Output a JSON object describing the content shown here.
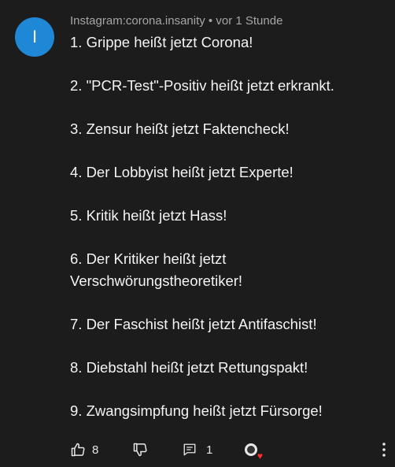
{
  "comment": {
    "avatar_letter": "I",
    "author": "Instagram:corona.insanity",
    "separator": " • ",
    "time": "vor 1 Stunde",
    "lines": [
      "1. Grippe heißt jetzt Corona!",
      "2. \"PCR-Test\"-Positiv heißt jetzt erkrankt.",
      "3. Zensur heißt jetzt Faktencheck!",
      "4. Der Lobbyist heißt jetzt Experte!",
      "5. Kritik heißt jetzt Hass!",
      "6. Der Kritiker heißt jetzt",
      "Verschwörungstheoretiker!",
      "7. Der Faschist heißt jetzt Antifaschist!",
      "8. Diebstahl heißt jetzt Rettungspakt!",
      "9. Zwangsimpfung heißt jetzt Fürsorge!"
    ]
  },
  "actions": {
    "like_icon": "thumbs-up-icon",
    "like_count": "8",
    "dislike_icon": "thumbs-down-icon",
    "reply_icon": "reply-comment-icon",
    "reply_count": "1",
    "creator_heart_icon": "creator-heart-icon",
    "more_icon": "more-vert-icon"
  },
  "colors": {
    "background": "#1c1c1c",
    "avatar": "#1e88d6",
    "heart": "#ff2d2d"
  }
}
